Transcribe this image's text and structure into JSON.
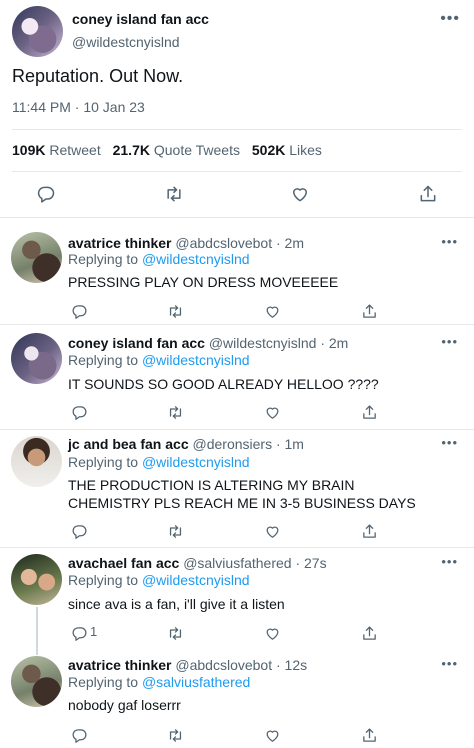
{
  "main_tweet": {
    "name": "coney island fan acc",
    "handle": "@wildestcnyislnd",
    "text": "Reputation. Out Now.",
    "time": "11:44 PM · 10 Jan 23",
    "stats": [
      {
        "count": "109K",
        "label": "Retweet"
      },
      {
        "count": "21.7K",
        "label": "Quote Tweets"
      },
      {
        "count": "502K",
        "label": "Likes"
      }
    ]
  },
  "replies": [
    {
      "name": "avatrice thinker",
      "handle": "@abdcslovebot",
      "age": "· 2m",
      "replying_label": "Replying to",
      "replying_to": "@wildestcnyislnd",
      "text": "PRESSING PLAY ON DRESS MOVEEEEE",
      "reply_count": ""
    },
    {
      "name": "coney island fan acc",
      "handle": "@wildestcnyislnd",
      "age": "· 2m",
      "replying_label": "Replying to",
      "replying_to": "@wildestcnyislnd",
      "text": "IT SOUNDS SO GOOD ALREADY HELLOO ????",
      "reply_count": ""
    },
    {
      "name": "jc and bea fan acc",
      "handle": "@deronsiers",
      "age": "· 1m",
      "replying_label": "Replying to",
      "replying_to": "@wildestcnyislnd",
      "text": "THE PRODUCTION IS ALTERING MY BRAIN CHEMISTRY PLS REACH ME IN 3-5 BUSINESS DAYS",
      "reply_count": ""
    },
    {
      "name": "avachael fan acc",
      "handle": "@salviusfathered",
      "age": "· 27s",
      "replying_label": "Replying to",
      "replying_to": "@wildestcnyislnd",
      "text": "since ava is a fan, i'll give it a listen",
      "reply_count": "1"
    },
    {
      "name": "avatrice thinker",
      "handle": "@abdcslovebot",
      "age": "· 12s",
      "replying_label": "Replying to",
      "replying_to": "@salviusfathered",
      "text": "nobody gaf loserrr",
      "reply_count": ""
    }
  ],
  "icons": [
    "reply-icon",
    "retweet-icon",
    "like-icon",
    "share-icon",
    "more-icon"
  ],
  "colors": {
    "link": "#1d9bf0",
    "muted": "#536471",
    "text": "#0f1419",
    "divider": "#e6e8ea"
  }
}
